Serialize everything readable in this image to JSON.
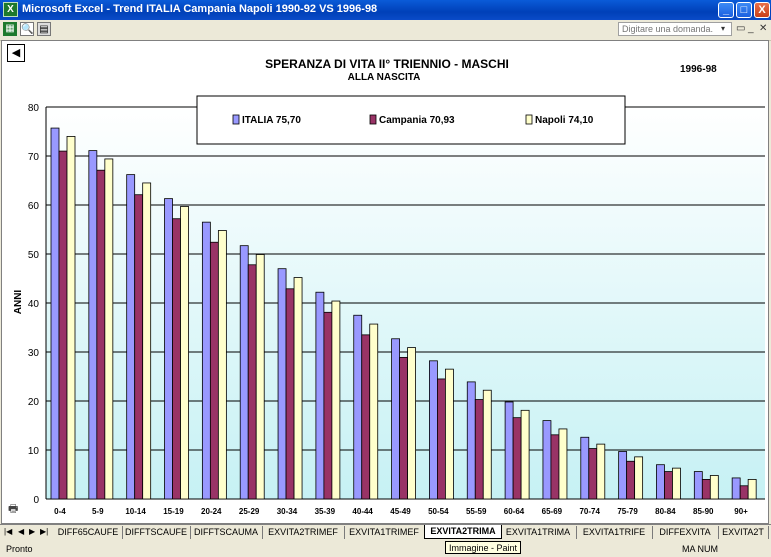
{
  "window": {
    "title": "Microsoft Excel - Trend ITALIA Campania Napoli 1990-92 VS 1996-98",
    "app_icon": "excel-icon",
    "controls": {
      "minimize": "_",
      "maximize": "□",
      "close": "X"
    }
  },
  "menubar": {
    "search_placeholder": "Digitare una domanda."
  },
  "chart_data": {
    "type": "bar",
    "title": "SPERANZA DI VITA II° TRIENNIO - MASCHI",
    "subtitle": "ALLA NASCITA",
    "period": "1996-98",
    "ylabel": "ANNI",
    "xlabel": "",
    "ylim": [
      0,
      80
    ],
    "yticks": [
      "0",
      "10",
      "20",
      "30",
      "40",
      "50",
      "60",
      "70",
      "80"
    ],
    "grid": true,
    "legend_position": "top-center",
    "categories": [
      "0-4",
      "5-9",
      "10-14",
      "15-19",
      "20-24",
      "25-29",
      "30-34",
      "35-39",
      "40-44",
      "45-49",
      "50-54",
      "55-59",
      "60-64",
      "65-69",
      "70-74",
      "75-79",
      "80-84",
      "85-90",
      "90+"
    ],
    "series": [
      {
        "name": "ITALIA 75,70",
        "color": "#9999ff",
        "values": [
          75.7,
          71.1,
          66.2,
          61.3,
          56.5,
          51.7,
          47.0,
          42.2,
          37.5,
          32.7,
          28.2,
          23.9,
          19.8,
          16.0,
          12.6,
          9.7,
          7.0,
          5.6,
          4.3
        ]
      },
      {
        "name": "Campania 70,93",
        "color": "#993366",
        "values": [
          71.0,
          67.1,
          62.1,
          57.2,
          52.4,
          47.8,
          42.9,
          38.1,
          33.5,
          28.9,
          24.5,
          20.3,
          16.6,
          13.1,
          10.3,
          7.7,
          5.6,
          4.0,
          2.7
        ]
      },
      {
        "name": "Napoli 74,10",
        "color": "#ffffcc",
        "values": [
          74.0,
          69.4,
          64.5,
          59.7,
          54.8,
          49.9,
          45.2,
          40.4,
          35.7,
          30.9,
          26.5,
          22.2,
          18.1,
          14.3,
          11.2,
          8.6,
          6.3,
          4.8,
          4.0
        ]
      }
    ]
  },
  "sheet_tabs": [
    "DIFF65CAUFE",
    "DIFFTSCAUFE",
    "DIFFTSCAUMA",
    "EXVITA2TRIMEF",
    "EXVITA1TRIMEF",
    "EXVITA2TRIMA",
    "EXVITA1TRIMA",
    "EXVITA1TRIFE",
    "DIFFEXVITA",
    "EXVITA2T"
  ],
  "active_tab": "EXVITA2TRIMA",
  "tooltip": "Immagine - Paint",
  "status": {
    "left": "Pronto",
    "right": "MA NUM"
  }
}
